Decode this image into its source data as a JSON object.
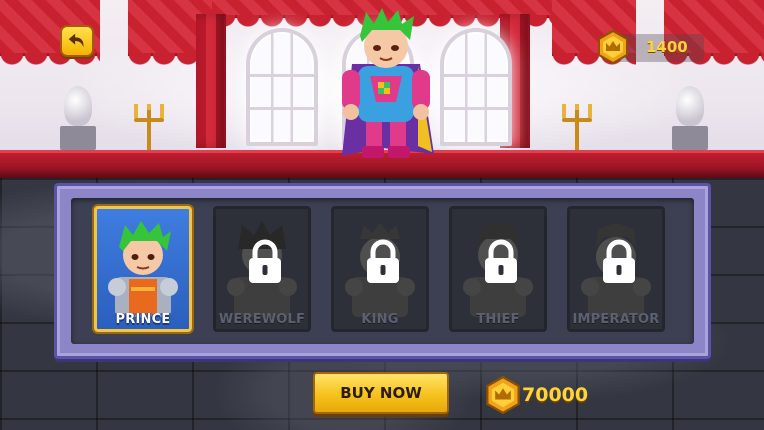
{
  "header": {
    "back_icon": "back-arrow-icon",
    "coin_icon": "crown-coin-icon",
    "coin_balance": "1400"
  },
  "characters": [
    {
      "label": "PRINCE",
      "locked": false,
      "selected": true
    },
    {
      "label": "WEREWOLF",
      "locked": true,
      "selected": false
    },
    {
      "label": "KING",
      "locked": true,
      "selected": false
    },
    {
      "label": "THIEF",
      "locked": true,
      "selected": false
    },
    {
      "label": "IMPERATOR",
      "locked": true,
      "selected": false
    }
  ],
  "purchase": {
    "buy_label": "BUY NOW",
    "price": "70000",
    "price_icon": "crown-coin-icon"
  },
  "colors": {
    "gold": "#ffd43a",
    "button_yellow": "#f6c21d",
    "panel_purple": "#8c86c8",
    "selected_card_blue": "#3f7de0",
    "curtain_red": "#c8212f"
  }
}
